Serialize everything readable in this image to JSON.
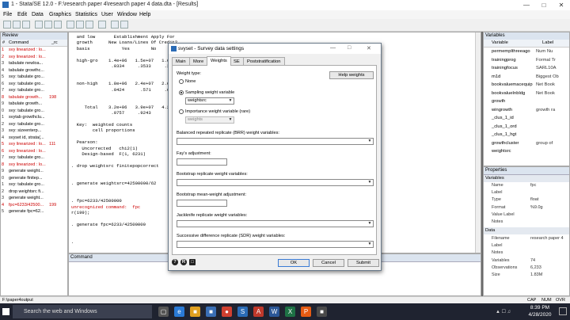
{
  "window": {
    "title": "1 - Stata/SE 12.0 - F:\\research paper 4\\research paper 4 data.dta - [Results]"
  },
  "menu": [
    "File",
    "Edit",
    "Data",
    "Graphics",
    "Statistics",
    "User",
    "Window",
    "Help"
  ],
  "review": {
    "title": "Review",
    "col_num": "#",
    "col_cmd": "Command",
    "col_rc": "_rc",
    "items": [
      {
        "n": "1",
        "text": "svy linearized : lo...",
        "rc": "",
        "err": true
      },
      {
        "n": "2",
        "text": "svy linearized : lo...",
        "rc": "",
        "err": true
      },
      {
        "n": "3",
        "text": "tabulate newloa...",
        "rc": "",
        "err": false
      },
      {
        "n": "4",
        "text": "tabulate growthc...",
        "rc": "",
        "err": false
      },
      {
        "n": "5",
        "text": "svy: tabulate gro...",
        "rc": "",
        "err": false
      },
      {
        "n": "6",
        "text": "svy: tabulate gro...",
        "rc": "",
        "err": false
      },
      {
        "n": "7",
        "text": "svy: tabulate gro...",
        "rc": "",
        "err": false
      },
      {
        "n": "8",
        "text": "tabulate growth...",
        "rc": "198",
        "err": true
      },
      {
        "n": "9",
        "text": "tabulate growth...",
        "rc": "",
        "err": false
      },
      {
        "n": "0",
        "text": "svy: tabulate gro...",
        "rc": "",
        "err": false
      },
      {
        "n": "1",
        "text": "svytab growthclu...",
        "rc": "",
        "err": false
      },
      {
        "n": "2",
        "text": "svy: tabulate gro...",
        "rc": "",
        "err": false
      },
      {
        "n": "3",
        "text": "svy: sizeenterp...",
        "rc": "",
        "err": false
      },
      {
        "n": "4",
        "text": "svyset id, strata(...",
        "rc": "",
        "err": false
      },
      {
        "n": "5",
        "text": "svy linearized : lo...",
        "rc": "111",
        "err": true
      },
      {
        "n": "6",
        "text": "svy linearized : lo...",
        "rc": "",
        "err": true
      },
      {
        "n": "7",
        "text": "svy: tabulate gro...",
        "rc": "",
        "err": false
      },
      {
        "n": "8",
        "text": "svy linearized : lo...",
        "rc": "",
        "err": true
      },
      {
        "n": "9",
        "text": "generate weight...",
        "rc": "",
        "err": false
      },
      {
        "n": "0",
        "text": "generate finitep...",
        "rc": "",
        "err": false
      },
      {
        "n": "1",
        "text": "svy: tabulate gro...",
        "rc": "",
        "err": false
      },
      {
        "n": "2",
        "text": "drop weightsrc fi...",
        "rc": "",
        "err": false
      },
      {
        "n": "3",
        "text": "generate weight...",
        "rc": "",
        "err": false
      },
      {
        "n": "4",
        "text": "fpc=6233/42500...",
        "rc": "199",
        "err": true
      },
      {
        "n": "5",
        "text": "generate fpc=62...",
        "rc": "",
        "err": false
      }
    ]
  },
  "results": {
    "lines": [
      {
        "text": "  and low       Establishment Apply For",
        "err": false
      },
      {
        "text": "  growth      New Loans/Lines Of Credit?",
        "err": false
      },
      {
        "text": "  basis            Yes        No       To",
        "err": false
      },
      {
        "text": "",
        "err": false
      },
      {
        "text": "  high-gro    1.4e+06   1.5e+07   1.6e",
        "err": false
      },
      {
        "text": "               .0334     .3533     .3",
        "err": false
      },
      {
        "text": "",
        "err": false
      },
      {
        "text": "",
        "err": false
      },
      {
        "text": "  non-high    1.8e+06   2.4e+07   2.6e",
        "err": false
      },
      {
        "text": "               .0424      .571     .6",
        "err": false
      },
      {
        "text": "",
        "err": false
      },
      {
        "text": "",
        "err": false
      },
      {
        "text": "     Total    3.2e+06   3.9e+07   4.2e",
        "err": false
      },
      {
        "text": "               .0757     .9243",
        "err": false
      },
      {
        "text": "",
        "err": false
      },
      {
        "text": "  Key:  weighted counts",
        "err": false
      },
      {
        "text": "        cell proportions",
        "err": false
      },
      {
        "text": "",
        "err": false
      },
      {
        "text": "  Pearson:",
        "err": false
      },
      {
        "text": "    Uncorrected   chi2(1)",
        "err": false
      },
      {
        "text": "    Design-based  F(1, 6231)",
        "err": false
      },
      {
        "text": "",
        "err": false
      },
      {
        "text": ". drop weightsrc finitepopcorrect",
        "err": false
      },
      {
        "text": "",
        "err": false
      },
      {
        "text": "",
        "err": false
      },
      {
        "text": ". generate weightsrc=42500000/62",
        "err": false
      },
      {
        "text": "",
        "err": false
      },
      {
        "text": "",
        "err": false
      },
      {
        "text": ". fpc=6233/42500000",
        "err": false
      },
      {
        "text": "unrecognized command:  fpc",
        "err": true
      },
      {
        "text": "r(199);",
        "err": false
      },
      {
        "text": "",
        "err": false
      },
      {
        "text": ". generate fpc=6233/42500000",
        "err": false
      },
      {
        "text": "",
        "err": false
      },
      {
        "text": "",
        "err": false
      },
      {
        "text": ".",
        "err": false
      }
    ]
  },
  "command": {
    "title": "Command"
  },
  "variables": {
    "title": "Variables",
    "col_name": "Variable",
    "col_label": "Label",
    "items": [
      {
        "name": "permemplthreeago",
        "label": "Num Nu"
      },
      {
        "name": "trainingprog",
        "label": "Formal Tr"
      },
      {
        "name": "trainingfocus",
        "label": "SARL10A"
      },
      {
        "name": "m1d",
        "label": "Biggest Ob"
      },
      {
        "name": "bookvaluemacequip",
        "label": "Net Book"
      },
      {
        "name": "bookvalueInbldg",
        "label": "Net Book"
      },
      {
        "name": "growth",
        "label": ""
      },
      {
        "name": "wingrowth",
        "label": "growth ra"
      },
      {
        "name": "_clus_1_id",
        "label": ""
      },
      {
        "name": "_clus_1_ord",
        "label": ""
      },
      {
        "name": "_clus_1_hgt",
        "label": ""
      },
      {
        "name": "growthcluster",
        "label": "group of"
      },
      {
        "name": "weightsrc",
        "label": ""
      }
    ]
  },
  "properties": {
    "title": "Properties",
    "var_section": "Variables",
    "var_rows": [
      {
        "k": "Name",
        "v": "fpc"
      },
      {
        "k": "Label",
        "v": ""
      },
      {
        "k": "Type",
        "v": "float"
      },
      {
        "k": "Format",
        "v": "%9.0g"
      },
      {
        "k": "Value Label",
        "v": ""
      },
      {
        "k": "Notes",
        "v": ""
      }
    ],
    "data_section": "Data",
    "data_rows": [
      {
        "k": "Filename",
        "v": "research paper 4"
      },
      {
        "k": "Label",
        "v": ""
      },
      {
        "k": "Notes",
        "v": ""
      },
      {
        "k": "Variables",
        "v": "74"
      },
      {
        "k": "Observations",
        "v": "6,233"
      },
      {
        "k": "Size",
        "v": "1.83M"
      }
    ]
  },
  "statusbar": {
    "path": "F:\\paper4output",
    "caps": "CAP",
    "num": "NUM",
    "ovr": "OVR"
  },
  "taskbar": {
    "search": "Search the web and Windows",
    "time": "8:39 PM",
    "date": "4/28/2020"
  },
  "dialog": {
    "title": "svyset - Survey data settings",
    "tabs": [
      "Main",
      "More",
      "Weights",
      "SE",
      "Poststratification"
    ],
    "active_tab": "Weights",
    "weight_type_label": "Weight type:",
    "help_weights": "Help weights",
    "opt_none": "None",
    "opt_sampling": "Sampling weight variable",
    "sampling_value": "weightsrc",
    "opt_importance": "Importance weight variable (rare)",
    "importance_value": "weights",
    "brr_label": "Balanced repeated replicate (BRR) weight variables:",
    "fay_label": "Fay's adjustment:",
    "bootstrap_label": "Bootstrap replicate weight variables:",
    "bootstrap_mean_label": "Bootstrap mean-weight adjustment:",
    "jackknife_label": "Jackknife replicate weight variables:",
    "sdr_label": "Successive difference replicate (SDR) weight variables:",
    "ok": "OK",
    "cancel": "Cancel",
    "submit": "Submit"
  }
}
